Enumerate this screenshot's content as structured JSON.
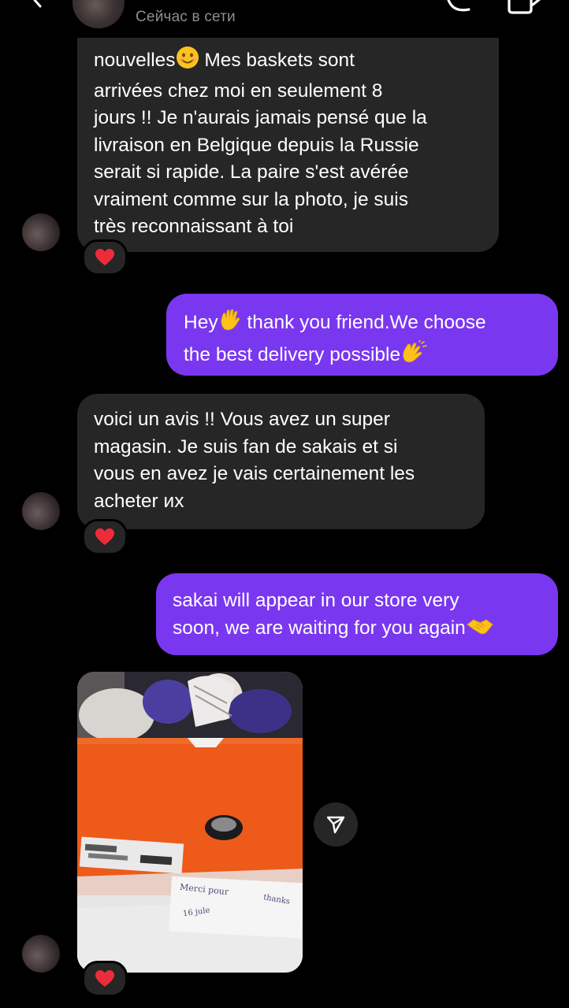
{
  "header": {
    "status": "Сейчас в сети",
    "back_icon": "chevron-left-icon",
    "call_icon": "phone-icon",
    "video_icon": "video-camera-icon"
  },
  "messages": [
    {
      "direction": "incoming",
      "text_parts": [
        "nouvelles",
        "smiling-face-emoji",
        " Mes baskets sont\narrivées chez moi en seulement 8\njours !! Je n'aurais jamais pensé que la\nlivraison en Belgique depuis la Russie\nserait si rapide. La paire s'est avérée\nvraiment comme sur la photo, je suis\ntrès reconnaissant à toi"
      ],
      "line1_prefix": "nouvelles",
      "line1_suffix": " Mes baskets sont",
      "rest": "arrivées chez moi en seulement 8\njours !! Je n'aurais jamais pensé que la\nlivraison en Belgique depuis la Russie\nserait si rapide. La paire s'est avérée\nvraiment comme sur la photo, je suis\ntrès reconnaissant à toi",
      "reaction": "heart"
    },
    {
      "direction": "outgoing",
      "line1_prefix": "Hey",
      "line1_suffix": " thank you friend.We choose",
      "line2_prefix": "the best delivery possible",
      "emojis": [
        "waving-hand-emoji",
        "clapping-hands-emoji"
      ]
    },
    {
      "direction": "incoming",
      "text": "voici un avis !! Vous avez un super\nmagasin. Je suis fan de sakais et si\nvous en avez je vais certainement les\nacheter их",
      "reaction": "heart"
    },
    {
      "direction": "outgoing",
      "line1": "sakai will appear in our store very",
      "line2_prefix": "soon, we are waiting for you again",
      "emojis": [
        "handshake-emoji"
      ]
    },
    {
      "direction": "incoming",
      "type": "photo",
      "photo_note_1": "Merci pour",
      "photo_note_2": "thanks",
      "photo_note_3": "16 jule",
      "reaction": "heart"
    }
  ],
  "colors": {
    "background": "#000000",
    "incoming_bubble": "#262626",
    "outgoing_bubble": "#7a37f0",
    "status_text": "#8e8e93",
    "heart": "#ed2c3a"
  }
}
